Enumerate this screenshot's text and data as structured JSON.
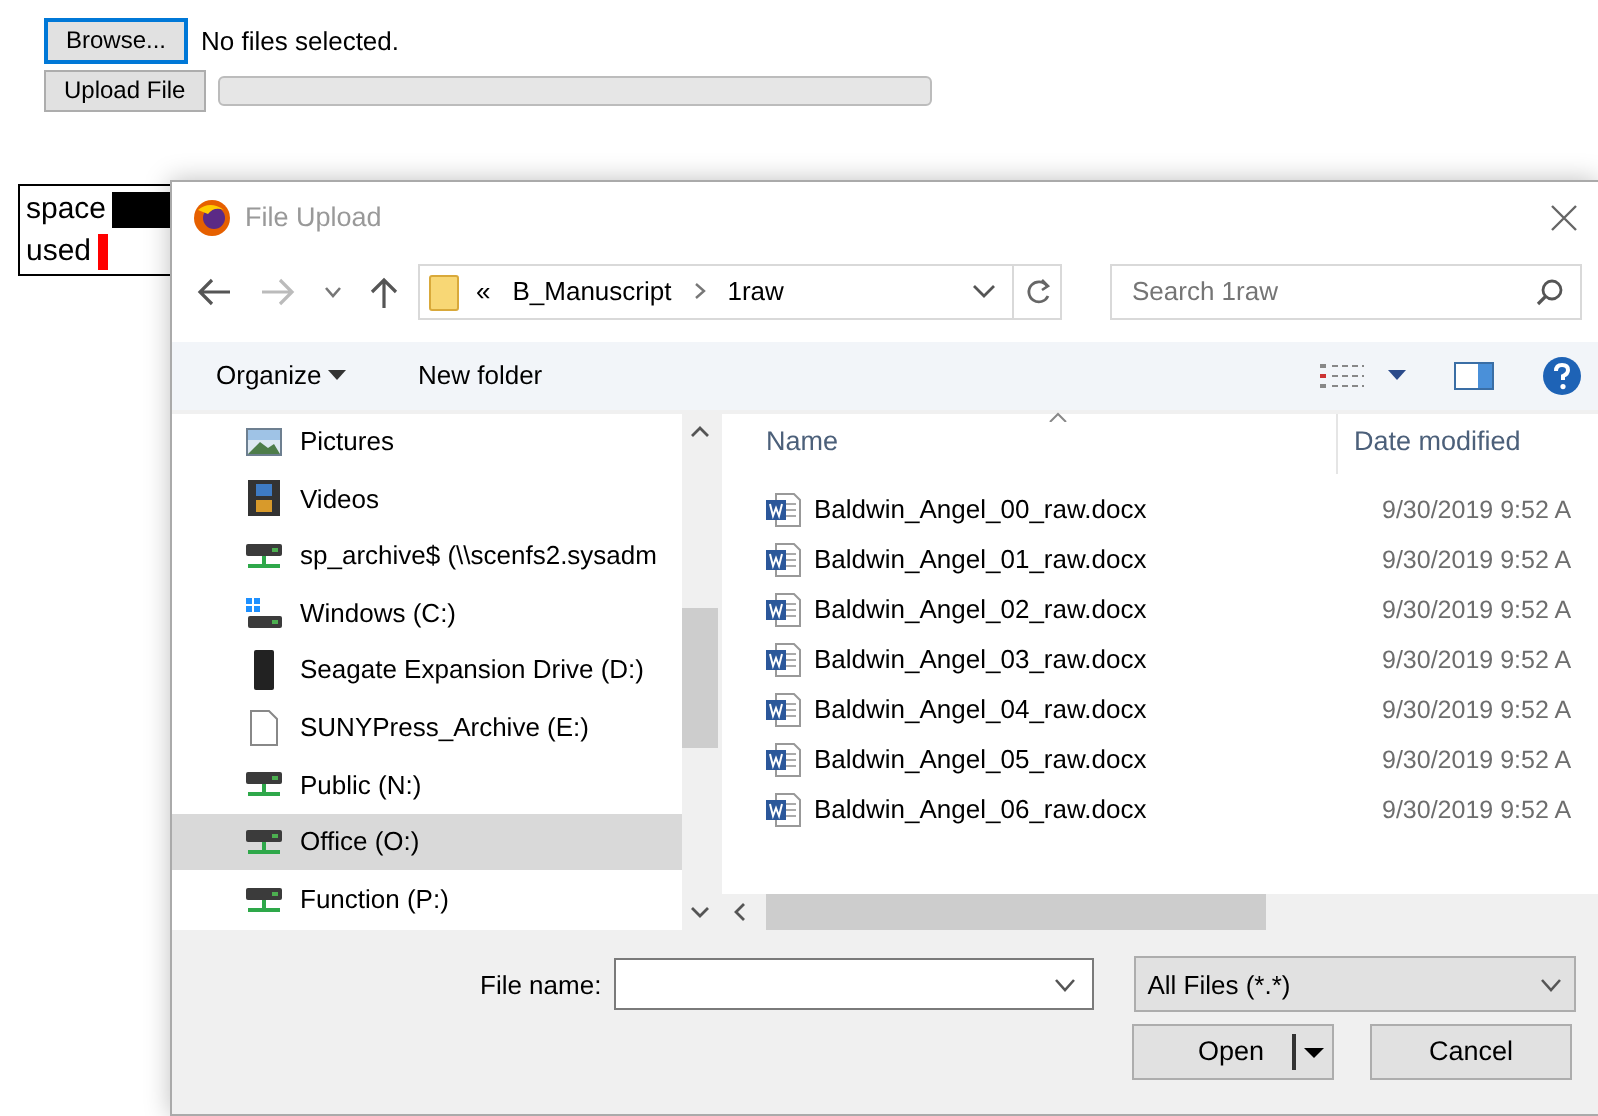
{
  "page": {
    "browse_button": "Browse...",
    "file_status": "No files selected.",
    "upload_button": "Upload File",
    "upload_progress": {
      "level": 0
    },
    "legend": [
      {
        "label": "space",
        "color": "#000000"
      },
      {
        "label": "used",
        "color": "#ff0000"
      }
    ]
  },
  "dialog": {
    "title": "File Upload",
    "address": {
      "overflow": "«",
      "crumbs": [
        "B_Manuscript",
        "1raw"
      ]
    },
    "search": {
      "placeholder": "Search 1raw"
    },
    "toolbar": {
      "organize": "Organize",
      "new_folder": "New folder"
    },
    "nav_items": [
      {
        "label": "Pictures",
        "kind": "pictures",
        "selected": false
      },
      {
        "label": "Videos",
        "kind": "videos",
        "selected": false
      },
      {
        "label": "sp_archive$ (\\\\scenfs2.sysadm",
        "kind": "network",
        "selected": false
      },
      {
        "label": "Windows (C:)",
        "kind": "system",
        "selected": false
      },
      {
        "label": "Seagate Expansion Drive (D:)",
        "kind": "external",
        "selected": false
      },
      {
        "label": "SUNYPress_Archive (E:)",
        "kind": "blank",
        "selected": false
      },
      {
        "label": "Public (N:)",
        "kind": "network",
        "selected": false
      },
      {
        "label": "Office (O:)",
        "kind": "network",
        "selected": true
      },
      {
        "label": "Function (P:)",
        "kind": "network",
        "selected": false
      }
    ],
    "columns": [
      "Name",
      "Date modified"
    ],
    "files": [
      {
        "name": "Baldwin_Angel_00_raw.docx",
        "date": "9/30/2019 9:52 A"
      },
      {
        "name": "Baldwin_Angel_01_raw.docx",
        "date": "9/30/2019 9:52 A"
      },
      {
        "name": "Baldwin_Angel_02_raw.docx",
        "date": "9/30/2019 9:52 A"
      },
      {
        "name": "Baldwin_Angel_03_raw.docx",
        "date": "9/30/2019 9:52 A"
      },
      {
        "name": "Baldwin_Angel_04_raw.docx",
        "date": "9/30/2019 9:52 A"
      },
      {
        "name": "Baldwin_Angel_05_raw.docx",
        "date": "9/30/2019 9:52 A"
      },
      {
        "name": "Baldwin_Angel_06_raw.docx",
        "date": "9/30/2019 9:52 A"
      }
    ],
    "file_name_label": "File name:",
    "file_type": "All Files (*.*)",
    "buttons": {
      "open": "Open",
      "cancel": "Cancel"
    }
  }
}
